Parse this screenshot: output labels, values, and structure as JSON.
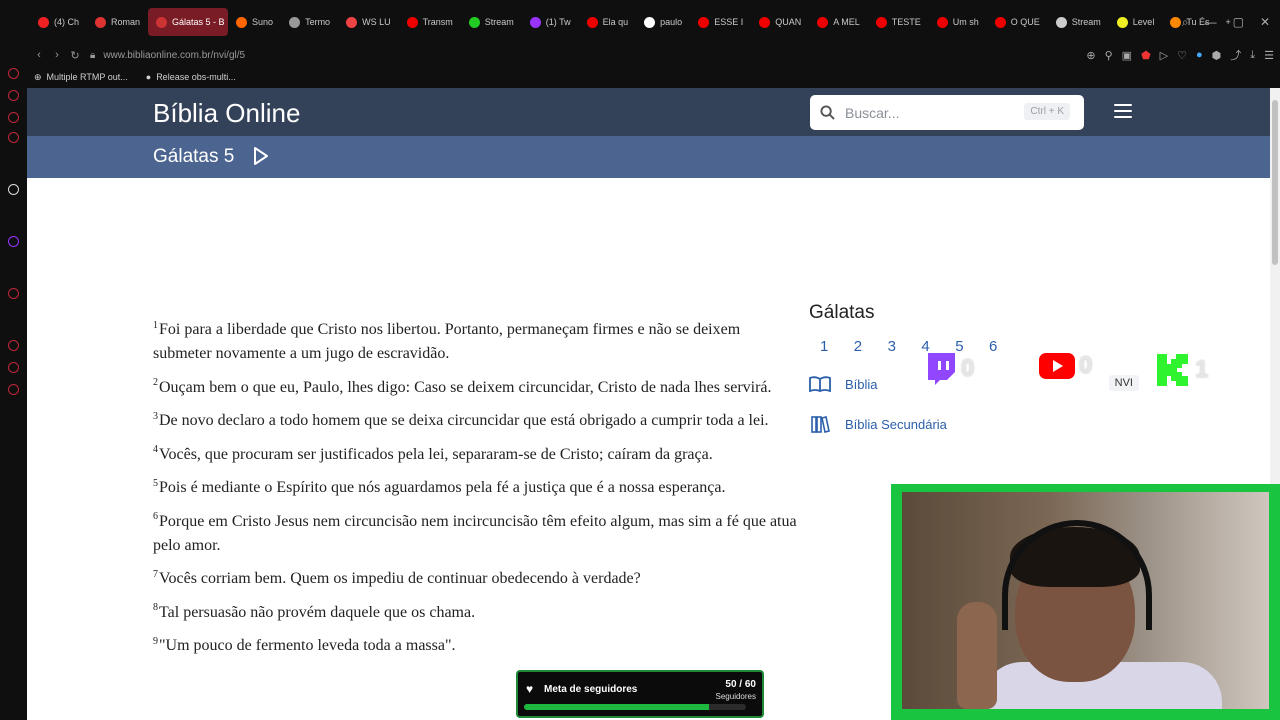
{
  "browser": {
    "tabs": [
      {
        "label": "(4) Ch",
        "color": "#e22"
      },
      {
        "label": "Roman",
        "color": "#d33"
      },
      {
        "label": "Gálatas 5 - B",
        "color": "#c33",
        "active": true
      },
      {
        "label": "Suno",
        "color": "#f60"
      },
      {
        "label": "Termo",
        "color": "#999"
      },
      {
        "label": "WS LU",
        "color": "#e44"
      },
      {
        "label": "Transm",
        "color": "#e00"
      },
      {
        "label": "Stream",
        "color": "#2c2"
      },
      {
        "label": "(1) Tw",
        "color": "#93f"
      },
      {
        "label": "Ela qu",
        "color": "#e00"
      },
      {
        "label": "paulo",
        "color": "#fff"
      },
      {
        "label": "ESSE I",
        "color": "#e00"
      },
      {
        "label": "QUAN",
        "color": "#e00"
      },
      {
        "label": "A MEL",
        "color": "#e00"
      },
      {
        "label": "TESTE",
        "color": "#e00"
      },
      {
        "label": "Um sh",
        "color": "#e00"
      },
      {
        "label": "O QUE",
        "color": "#e00"
      },
      {
        "label": "Stream",
        "color": "#ccc"
      },
      {
        "label": "Level",
        "color": "#ee2"
      },
      {
        "label": "Tu És",
        "color": "#f80"
      }
    ],
    "url": "www.bibliaonline.com.br/nvi/gl/5",
    "bookmarks": [
      "Multiple RTMP out...",
      "Release obs-multi..."
    ]
  },
  "header": {
    "site_title": "Bíblia Online",
    "search_placeholder": "Buscar...",
    "search_shortcut": "Ctrl + K",
    "chapter_title": "Gálatas 5"
  },
  "verses": [
    {
      "n": "1",
      "text": "Foi para a liberdade que Cristo nos libertou. Portanto, permaneçam firmes e não se deixem submeter novamente a um jugo de escravidão."
    },
    {
      "n": "2",
      "text": "Ouçam bem o que eu, Paulo, lhes digo: Caso se deixem circuncidar, Cristo de nada lhes servirá."
    },
    {
      "n": "3",
      "text": "De novo declaro a todo homem que se deixa circuncidar que está obrigado a cumprir toda a lei."
    },
    {
      "n": "4",
      "text": "Vocês, que procuram ser justificados pela lei, separaram-se de Cristo; caíram da graça."
    },
    {
      "n": "5",
      "text": "Pois é mediante o Espírito que nós aguardamos pela fé a justiça que é a nossa esperança."
    },
    {
      "n": "6",
      "text": "Porque em Cristo Jesus nem circuncisão nem incircuncisão têm efeito algum, mas sim a fé que atua pelo amor."
    },
    {
      "n": "7",
      "text": "Vocês corriam bem. Quem os impediu de continuar obedecendo à verdade?"
    },
    {
      "n": "8",
      "text": "Tal persuasão não provém daquele que os chama."
    },
    {
      "n": "9",
      "text": "\"Um pouco de fermento leveda toda a massa\"."
    }
  ],
  "sidebar": {
    "book": "Gálatas",
    "chapters": [
      "1",
      "2",
      "3",
      "4",
      "5",
      "6"
    ],
    "bible_label": "Bíblia",
    "bible_version": "NVI",
    "secondary_label": "Bíblia Secundária"
  },
  "overlay": {
    "counters": {
      "twitch": "0",
      "youtube": "0",
      "kick": "1"
    },
    "goal_title": "Meta de seguidores",
    "goal_count": "50 / 60",
    "goal_sub": "Seguidores",
    "goal_progress": 0.833
  }
}
